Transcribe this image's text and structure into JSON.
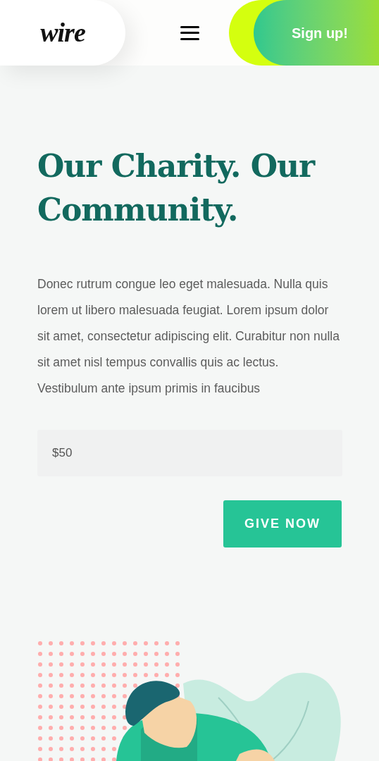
{
  "header": {
    "logo": "wire",
    "signup": "Sign up!"
  },
  "hero": {
    "title": "Our Charity. Our Community.",
    "body": "Donec rutrum congue leo eget malesuada. Nulla quis lorem ut libero malesuada feugiat. Lorem ipsum dolor sit amet, consectetur adipiscing elit. Curabitur non nulla sit amet nisl tempus convallis quis ac lectus.  Vestibulum ante ipsum primis in faucibus",
    "amount": "$50",
    "button": "GIVE NOW"
  }
}
